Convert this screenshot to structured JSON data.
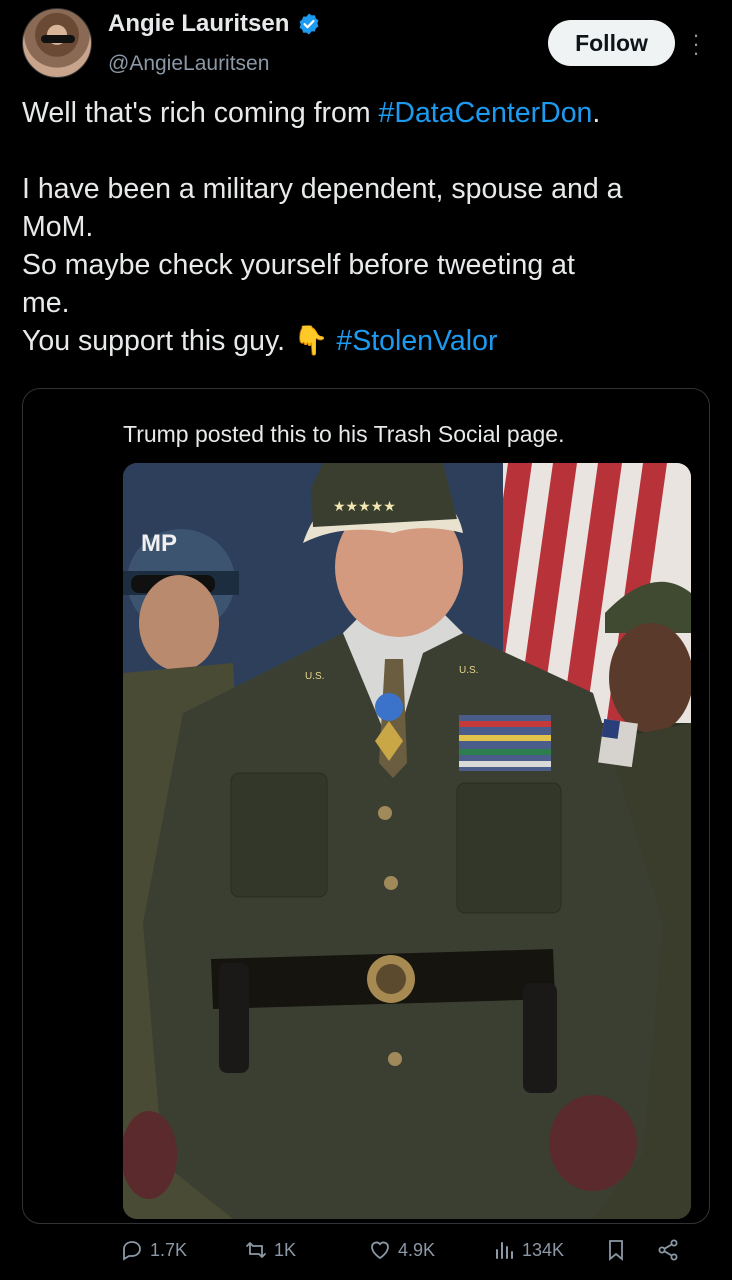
{
  "author": {
    "display_name": "Angie Lauritsen",
    "handle": "@AngieLauritsen",
    "verified": true
  },
  "follow_label": "Follow",
  "tweet": {
    "line1_prefix": "Well that's rich coming from ",
    "line1_hashtag": "#DataCenterDon",
    "line1_suffix": ".",
    "line2": "I have been a military dependent, spouse and a",
    "line3": "MoM.",
    "line4": "So maybe check yourself before tweeting at",
    "line5": "me.",
    "line6_prefix": "You support this guy. ",
    "line6_emoji": "👇",
    "line6_hashtag": "#StolenValor"
  },
  "quote": {
    "caption": "Trump posted this to his Trash Social page.",
    "photo_labels": {
      "helmet": "MP",
      "cap_stars": "★★★★★",
      "collar_left": "U.S.",
      "collar_right": "U.S."
    }
  },
  "actions": {
    "replies": "1.7K",
    "reposts": "1K",
    "likes": "4.9K",
    "views": "134K"
  },
  "colors": {
    "background": "#000000",
    "text": "#e7e9ea",
    "muted": "#8b98a5",
    "accent": "#1d9bf0",
    "border": "#2f3336"
  }
}
